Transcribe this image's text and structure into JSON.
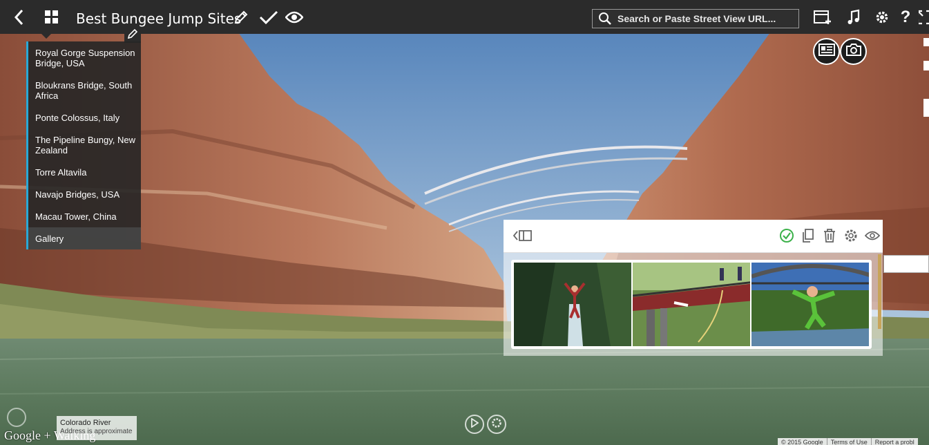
{
  "topbar": {
    "title": "Best Bungee Jump Sites",
    "search_placeholder": "Search or Paste Street View URL...",
    "icons": [
      "back-icon",
      "grid-icon",
      "pencil-icon",
      "check-icon",
      "eye-icon",
      "search-icon",
      "add-panel-icon",
      "music-icon",
      "gear-icon",
      "help-icon",
      "fullscreen-icon"
    ]
  },
  "scene_list": {
    "items": [
      "Royal Gorge Suspension Bridge, USA",
      "Bloukrans Bridge, South Africa",
      "Ponte Colossus, Italy",
      "The Pipeline Bungy, New Zealand",
      "Torre Altavila",
      "Navajo Bridges, USA",
      "Macau Tower, China",
      "Gallery"
    ]
  },
  "gallery_panel": {
    "toolbar_icons": [
      "collapse-panel-icon",
      "check-circle-icon",
      "copy-icon",
      "trash-icon",
      "gear-icon",
      "eye-icon"
    ],
    "accent_check_color": "#3cb14a",
    "thumbnails": [
      "bungee-jumper-waterfall",
      "bungee-jumper-bridge",
      "bungee-jumper-river-bridge"
    ]
  },
  "address": {
    "line1": "Colorado River",
    "line2": "Address is approximate"
  },
  "google_logo": "Google + Walking",
  "footer": {
    "copyright": "© 2015 Google",
    "terms": "Terms of Use",
    "report": "Report a probl"
  },
  "colors": {
    "topbar_bg": "#2b2b2b",
    "accent_blue": "#29a8d8"
  }
}
